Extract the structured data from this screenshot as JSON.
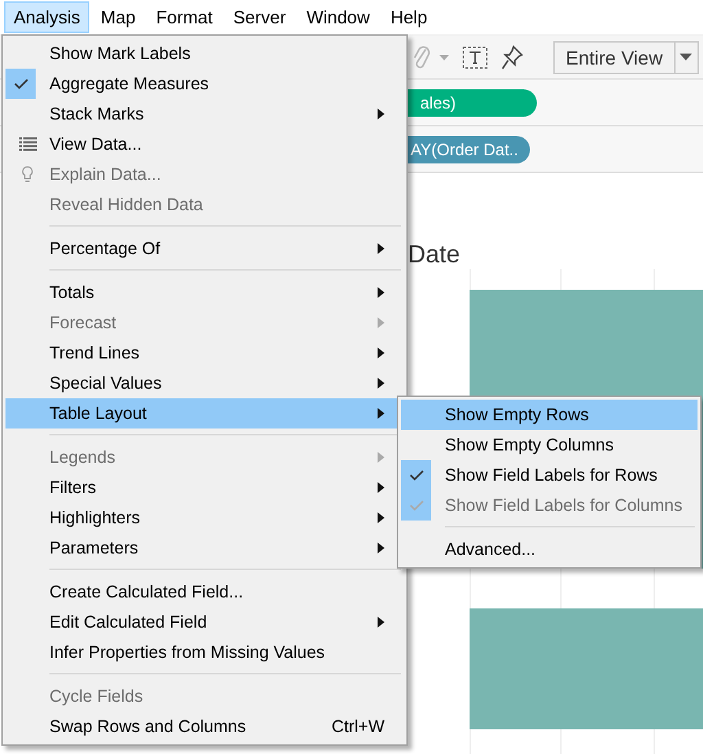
{
  "menubar": [
    {
      "label": "Analysis",
      "selected": true
    },
    {
      "label": "Map",
      "selected": false
    },
    {
      "label": "Format",
      "selected": false
    },
    {
      "label": "Server",
      "selected": false
    },
    {
      "label": "Window",
      "selected": false
    },
    {
      "label": "Help",
      "selected": false
    }
  ],
  "toolbar": {
    "view_dropdown": "Entire View"
  },
  "shelves": [
    {
      "label": "ales)",
      "color": "#00b180"
    },
    {
      "label": "AY(Order Dat..",
      "color": "#4996b2"
    }
  ],
  "sheet": {
    "title": "Date"
  },
  "menu": {
    "items": [
      {
        "kind": "item",
        "label": "Show Mark Labels",
        "checked": false,
        "disabled": false,
        "submenu": false,
        "selected": false
      },
      {
        "kind": "item",
        "label": "Aggregate Measures",
        "checked": true,
        "disabled": false,
        "submenu": false,
        "selected": false
      },
      {
        "kind": "item",
        "label": "Stack Marks",
        "checked": false,
        "disabled": false,
        "submenu": true,
        "selected": false
      },
      {
        "kind": "grid-item",
        "label": "View Data...",
        "checked": false,
        "disabled": false,
        "submenu": false,
        "selected": false
      },
      {
        "kind": "bulb-item",
        "label": "Explain Data...",
        "checked": false,
        "disabled": true,
        "submenu": false,
        "selected": false
      },
      {
        "kind": "item",
        "label": "Reveal Hidden Data",
        "checked": false,
        "disabled": true,
        "submenu": false,
        "selected": false
      },
      {
        "kind": "separator"
      },
      {
        "kind": "item",
        "label": "Percentage Of",
        "checked": false,
        "disabled": false,
        "submenu": true,
        "selected": false
      },
      {
        "kind": "separator"
      },
      {
        "kind": "item",
        "label": "Totals",
        "checked": false,
        "disabled": false,
        "submenu": true,
        "selected": false
      },
      {
        "kind": "item",
        "label": "Forecast",
        "checked": false,
        "disabled": true,
        "submenu": true,
        "selected": false
      },
      {
        "kind": "item",
        "label": "Trend Lines",
        "checked": false,
        "disabled": false,
        "submenu": true,
        "selected": false
      },
      {
        "kind": "item",
        "label": "Special Values",
        "checked": false,
        "disabled": false,
        "submenu": true,
        "selected": false
      },
      {
        "kind": "item",
        "label": "Table Layout",
        "checked": false,
        "disabled": false,
        "submenu": true,
        "selected": true
      },
      {
        "kind": "separator"
      },
      {
        "kind": "item",
        "label": "Legends",
        "checked": false,
        "disabled": true,
        "submenu": true,
        "selected": false
      },
      {
        "kind": "item",
        "label": "Filters",
        "checked": false,
        "disabled": false,
        "submenu": true,
        "selected": false
      },
      {
        "kind": "item",
        "label": "Highlighters",
        "checked": false,
        "disabled": false,
        "submenu": true,
        "selected": false
      },
      {
        "kind": "item",
        "label": "Parameters",
        "checked": false,
        "disabled": false,
        "submenu": true,
        "selected": false
      },
      {
        "kind": "separator"
      },
      {
        "kind": "item",
        "label": "Create Calculated Field...",
        "checked": false,
        "disabled": false,
        "submenu": false,
        "selected": false
      },
      {
        "kind": "item",
        "label": "Edit Calculated Field",
        "checked": false,
        "disabled": false,
        "submenu": true,
        "selected": false
      },
      {
        "kind": "item",
        "label": "Infer Properties from Missing Values",
        "checked": false,
        "disabled": false,
        "submenu": false,
        "selected": false
      },
      {
        "kind": "separator"
      },
      {
        "kind": "item",
        "label": "Cycle Fields",
        "checked": false,
        "disabled": true,
        "submenu": false,
        "selected": false
      },
      {
        "kind": "item",
        "label": "Swap Rows and Columns",
        "shortcut": "Ctrl+W",
        "checked": false,
        "disabled": false,
        "submenu": false,
        "selected": false
      }
    ]
  },
  "submenu": {
    "items": [
      {
        "kind": "item",
        "label": "Show Empty Rows",
        "checked": false,
        "disabled": false,
        "selected": true
      },
      {
        "kind": "item",
        "label": "Show Empty Columns",
        "checked": false,
        "disabled": false,
        "selected": false
      },
      {
        "kind": "item",
        "label": "Show Field Labels for Rows",
        "checked": true,
        "disabled": false,
        "selected": false
      },
      {
        "kind": "item",
        "label": "Show Field Labels for Columns",
        "checked": true,
        "disabled": true,
        "selected": false
      },
      {
        "kind": "separator"
      },
      {
        "kind": "item",
        "label": "Advanced...",
        "checked": false,
        "disabled": false,
        "selected": false
      }
    ]
  }
}
